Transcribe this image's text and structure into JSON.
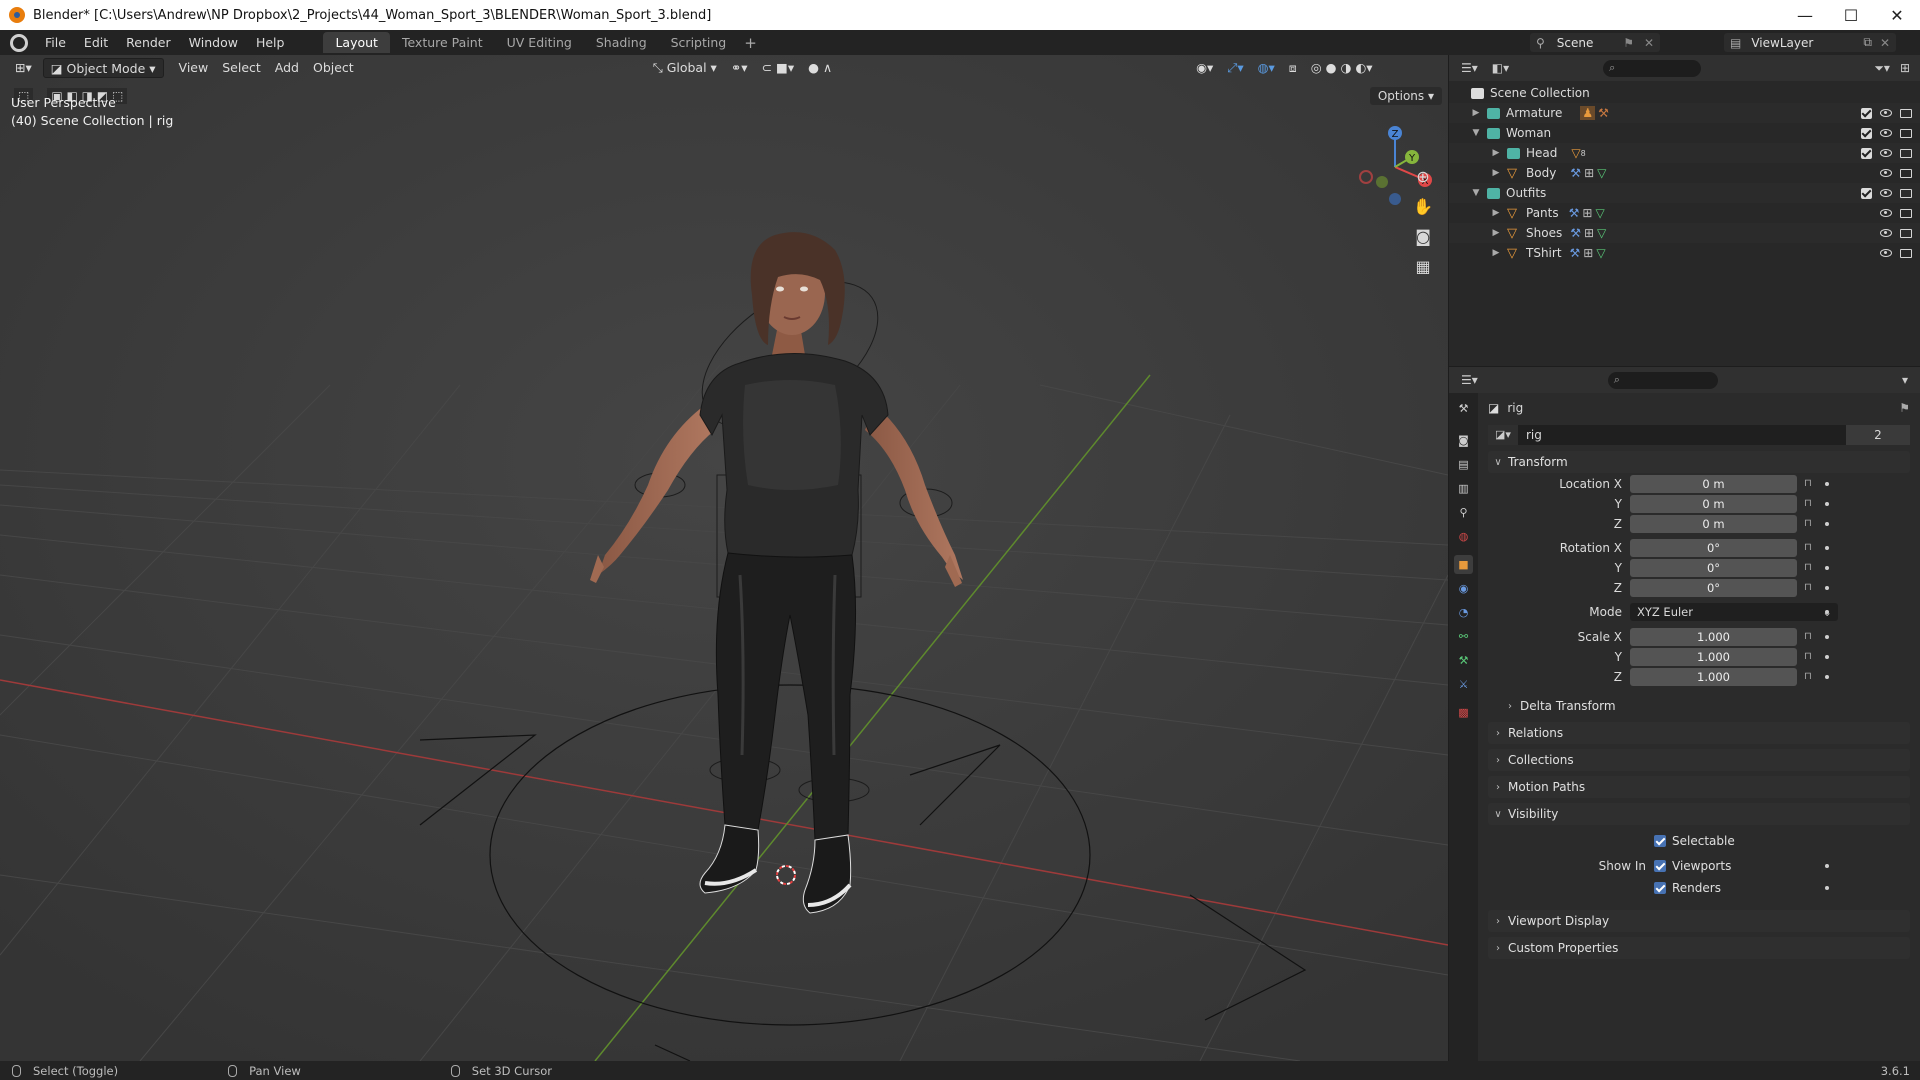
{
  "window": {
    "title": "Blender* [C:\\Users\\Andrew\\NP Dropbox\\2_Projects\\44_Woman_Sport_3\\BLENDER\\Woman_Sport_3.blend]",
    "minimize": "—",
    "maximize": "☐",
    "close": "✕"
  },
  "menu": [
    "File",
    "Edit",
    "Render",
    "Window",
    "Help"
  ],
  "workspaces": [
    "Layout",
    "Texture Paint",
    "UV Editing",
    "Shading",
    "Scripting"
  ],
  "workspace_add": "+",
  "scene_name": "Scene",
  "view_layer": "ViewLayer",
  "viewport": {
    "mode": "Object Mode",
    "menus": [
      "View",
      "Select",
      "Add",
      "Object"
    ],
    "orientation": "Global",
    "options": "Options",
    "perspective": "User Perspective",
    "collection_info": "(40) Scene Collection | rig",
    "gizmo": {
      "x": "X",
      "y": "Y",
      "z": "Z"
    }
  },
  "outliner": {
    "root": "Scene Collection",
    "items": [
      {
        "name": "Armature",
        "type": "collection",
        "depth": 1,
        "expanded": false
      },
      {
        "name": "Woman",
        "type": "collection",
        "depth": 1,
        "expanded": true
      },
      {
        "name": "Head",
        "type": "collection",
        "depth": 2,
        "expanded": false,
        "badge": "8"
      },
      {
        "name": "Body",
        "type": "mesh",
        "depth": 2,
        "expanded": false
      },
      {
        "name": "Outfits",
        "type": "collection",
        "depth": 1,
        "expanded": true
      },
      {
        "name": "Pants",
        "type": "mesh",
        "depth": 2,
        "expanded": false
      },
      {
        "name": "Shoes",
        "type": "mesh",
        "depth": 2,
        "expanded": false
      },
      {
        "name": "TShirt",
        "type": "mesh",
        "depth": 2,
        "expanded": false
      }
    ]
  },
  "properties": {
    "object_name": "rig",
    "datablock_name": "rig",
    "user_count": "2",
    "transform": {
      "header": "Transform",
      "location_label": "Location X",
      "location": [
        "0 m",
        "0 m",
        "0 m"
      ],
      "rotation_label": "Rotation X",
      "rotation": [
        "0°",
        "0°",
        "0°"
      ],
      "mode_label": "Mode",
      "mode": "XYZ Euler",
      "scale_label": "Scale X",
      "scale": [
        "1.000",
        "1.000",
        "1.000"
      ],
      "y": "Y",
      "z": "Z"
    },
    "delta_transform": "Delta Transform",
    "relations": "Relations",
    "collections": "Collections",
    "motion_paths": "Motion Paths",
    "visibility": {
      "header": "Visibility",
      "selectable": "Selectable",
      "show_in": "Show In",
      "viewports": "Viewports",
      "renders": "Renders"
    },
    "viewport_display": "Viewport Display",
    "custom_properties": "Custom Properties"
  },
  "statusbar": {
    "select": "Select (Toggle)",
    "pan": "Pan View",
    "cursor": "Set 3D Cursor",
    "version": "3.6.1"
  },
  "colors": {
    "accent": "#4772b3",
    "x_axis": "#e04848",
    "y_axis": "#86b53c",
    "z_axis": "#4a84d4",
    "collection": "#4fb3a5",
    "mesh": "#e89a3c"
  }
}
